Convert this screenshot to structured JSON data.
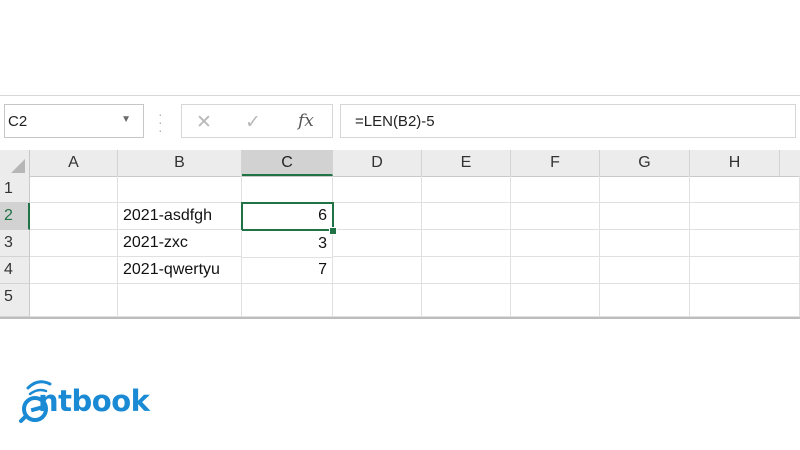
{
  "formula_bar": {
    "name_box": "C2",
    "formula": "=LEN(B2)-5",
    "fx_label": "fx"
  },
  "columns": [
    "A",
    "B",
    "C",
    "D",
    "E",
    "F",
    "G",
    "H"
  ],
  "rows": [
    "1",
    "2",
    "3",
    "4",
    "5"
  ],
  "cells": {
    "B2": "2021-asdfgh",
    "B3": "2021-zxc",
    "B4": "2021-qwertyu",
    "C2": "6",
    "C3": "3",
    "C4": "7"
  },
  "logo": {
    "text": "ntbook",
    "brand_color": "#1a8ad4"
  },
  "accent_color": "#217346"
}
